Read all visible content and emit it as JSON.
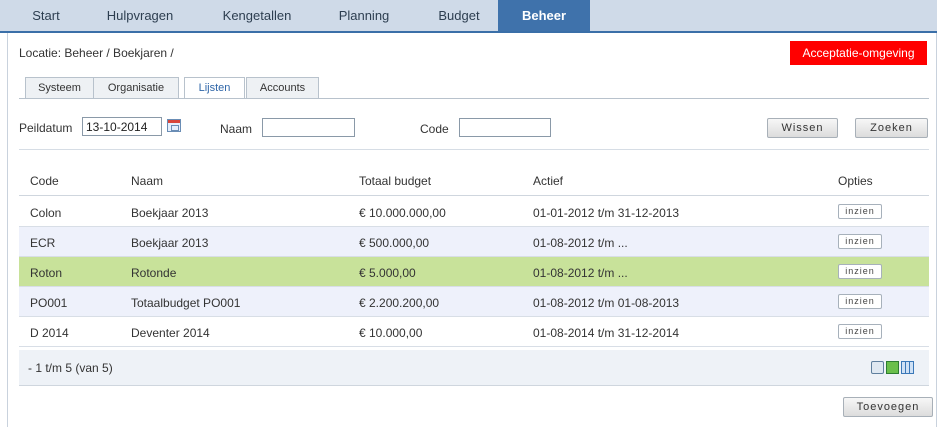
{
  "nav": {
    "tabs": [
      {
        "label": "Start",
        "active": false
      },
      {
        "label": "Hulpvragen",
        "active": false
      },
      {
        "label": "Kengetallen",
        "active": false
      },
      {
        "label": "Planning",
        "active": false
      },
      {
        "label": "Budget",
        "active": false
      },
      {
        "label": "Beheer",
        "active": true
      }
    ]
  },
  "location": "Locatie: Beheer / Boekjaren /",
  "environment_badge": "Acceptatie-omgeving",
  "subtabs": [
    {
      "label": "Systeem",
      "active": false
    },
    {
      "label": "Organisatie",
      "active": false
    },
    {
      "label": "Lijsten",
      "active": true
    },
    {
      "label": "Accounts",
      "active": false
    }
  ],
  "filters": {
    "peildatum_label": "Peildatum",
    "peildatum_value": "13-10-2014",
    "naam_label": "Naam",
    "naam_value": "",
    "code_label": "Code",
    "code_value": "",
    "wissen": "Wissen",
    "zoeken": "Zoeken"
  },
  "table": {
    "headers": {
      "code": "Code",
      "naam": "Naam",
      "budget": "Totaal budget",
      "actief": "Actief",
      "opties": "Opties"
    },
    "rows": [
      {
        "code": "Colon",
        "naam": "Boekjaar 2013",
        "budget": "€ 10.000.000,00",
        "actief": "01-01-2012 t/m 31-12-2013",
        "opties": "inzien"
      },
      {
        "code": "ECR",
        "naam": "Boekjaar 2013",
        "budget": "€ 500.000,00",
        "actief": "01-08-2012 t/m ...",
        "opties": "inzien"
      },
      {
        "code": "Roton",
        "naam": "Rotonde",
        "budget": "€ 5.000,00",
        "actief": "01-08-2012 t/m ...",
        "opties": "inzien"
      },
      {
        "code": "PO001",
        "naam": "Totaalbudget PO001",
        "budget": "€ 2.200.200,00",
        "actief": "01-08-2012 t/m 01-08-2013",
        "opties": "inzien"
      },
      {
        "code": "D 2014",
        "naam": "Deventer 2014",
        "budget": "€ 10.000,00",
        "actief": "01-08-2014 t/m 31-12-2014",
        "opties": "inzien"
      }
    ],
    "footer_text": "- 1 t/m 5 (van 5)"
  },
  "toevoegen": "Toevoegen",
  "colors": {
    "nav_bg": "#cfdae8",
    "nav_active": "#3f72ab",
    "badge": "#ff0000",
    "row_alt": "#eef1fb",
    "row_highlight": "#c8e29a"
  },
  "icons": [
    "print-icon",
    "excel-icon",
    "columns-icon",
    "calendar-icon"
  ]
}
